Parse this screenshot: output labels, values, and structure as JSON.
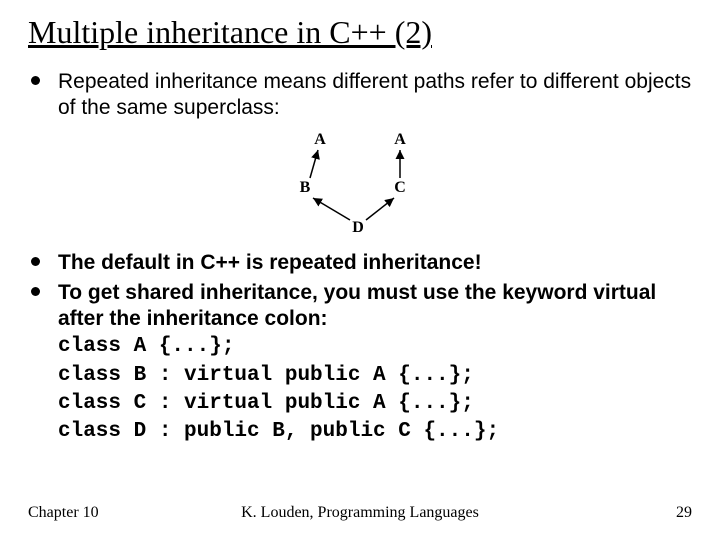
{
  "title": "Multiple inheritance in C++ (2)",
  "bullets": {
    "b1": "Repeated inheritance means different paths refer to different objects of the same superclass:",
    "b2": "The default in C++ is repeated inheritance!",
    "b3": "To get shared inheritance, you must use the keyword virtual after the inheritance colon:"
  },
  "diagram": {
    "A1": "A",
    "A2": "A",
    "B": "B",
    "C": "C",
    "D": "D"
  },
  "code": {
    "l1": "class A {...};",
    "l2": "class B : virtual public A {...};",
    "l3": "class C : virtual public A {...};",
    "l4": "class D : public B, public C {...};"
  },
  "footer": {
    "left": "Chapter 10",
    "center": "K. Louden, Programming Languages",
    "right": "29"
  }
}
